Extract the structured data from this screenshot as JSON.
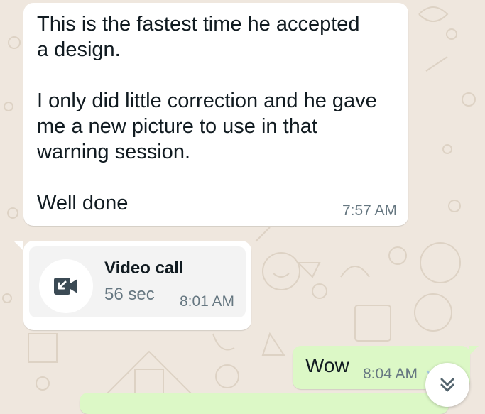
{
  "colors": {
    "wallpaper": "#efe7de",
    "incoming_bubble": "#ffffff",
    "outgoing_bubble": "#dcf8c6",
    "meta_text": "#667781",
    "read_ticks": "#a9cde6"
  },
  "messages": [
    {
      "direction": "incoming",
      "text": "This is the fastest time he accepted\na design.\n\nI only did little correction and he gave\nme a new picture to use in that\nwarning session.\n\nWell done",
      "time": "7:57 AM"
    },
    {
      "direction": "incoming",
      "type": "call",
      "icon": "missed-video-call-icon",
      "title": "Video call",
      "duration": "56 sec",
      "time": "8:01 AM"
    },
    {
      "direction": "outgoing",
      "text": "Wow",
      "time": "8:04 AM",
      "status_icon": "double-check-icon"
    }
  ],
  "scroll_button": {
    "icon": "double-chevron-down-icon"
  }
}
